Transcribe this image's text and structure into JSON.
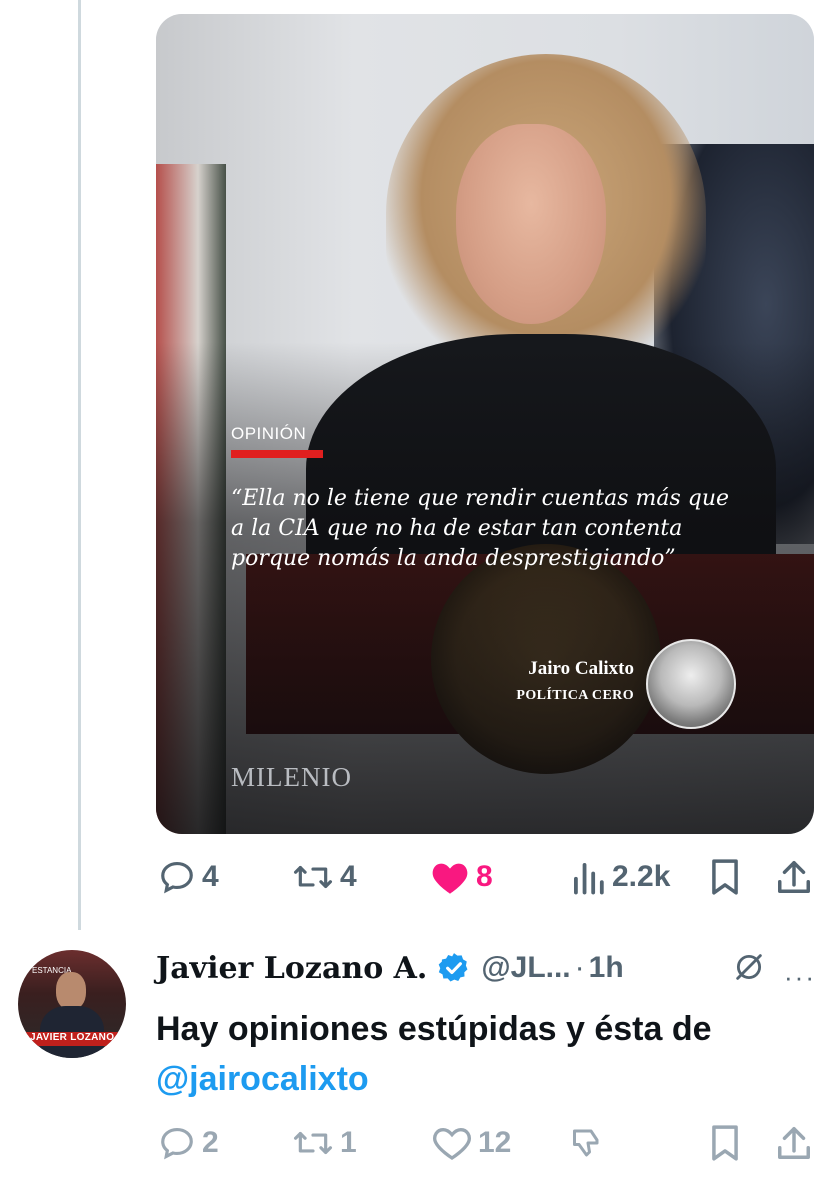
{
  "card": {
    "label": "OPINIÓN",
    "quote": "“Ella no le tiene que rendir cuentas más que a la CIA que no ha de estar tan contenta porque nomás la anda desprestigiando”",
    "author": "Jairo Calixto",
    "column": "POLÍTICA CERO",
    "brand": "MILENIO"
  },
  "tweet1_actions": {
    "replies": "4",
    "retweets": "4",
    "likes": "8",
    "views": "2.2k",
    "colors": {
      "muted": "#536471",
      "like": "#f91880"
    }
  },
  "reply": {
    "name": "Javier Lozano A.",
    "handle": "@JL...",
    "dot": "·",
    "time": "1h",
    "text_prefix": "Hay opiniones estúpidas y ésta de ",
    "mention": "@jairocalixto",
    "avatar_caption": "JAVIER LOZANO",
    "avatar_caption_small": "ESTANCIA",
    "more": "···",
    "actions": {
      "replies": "2",
      "retweets": "1",
      "likes": "12"
    },
    "colors": {
      "verified": "#1d9bf0",
      "mention": "#1d9bf0"
    }
  }
}
